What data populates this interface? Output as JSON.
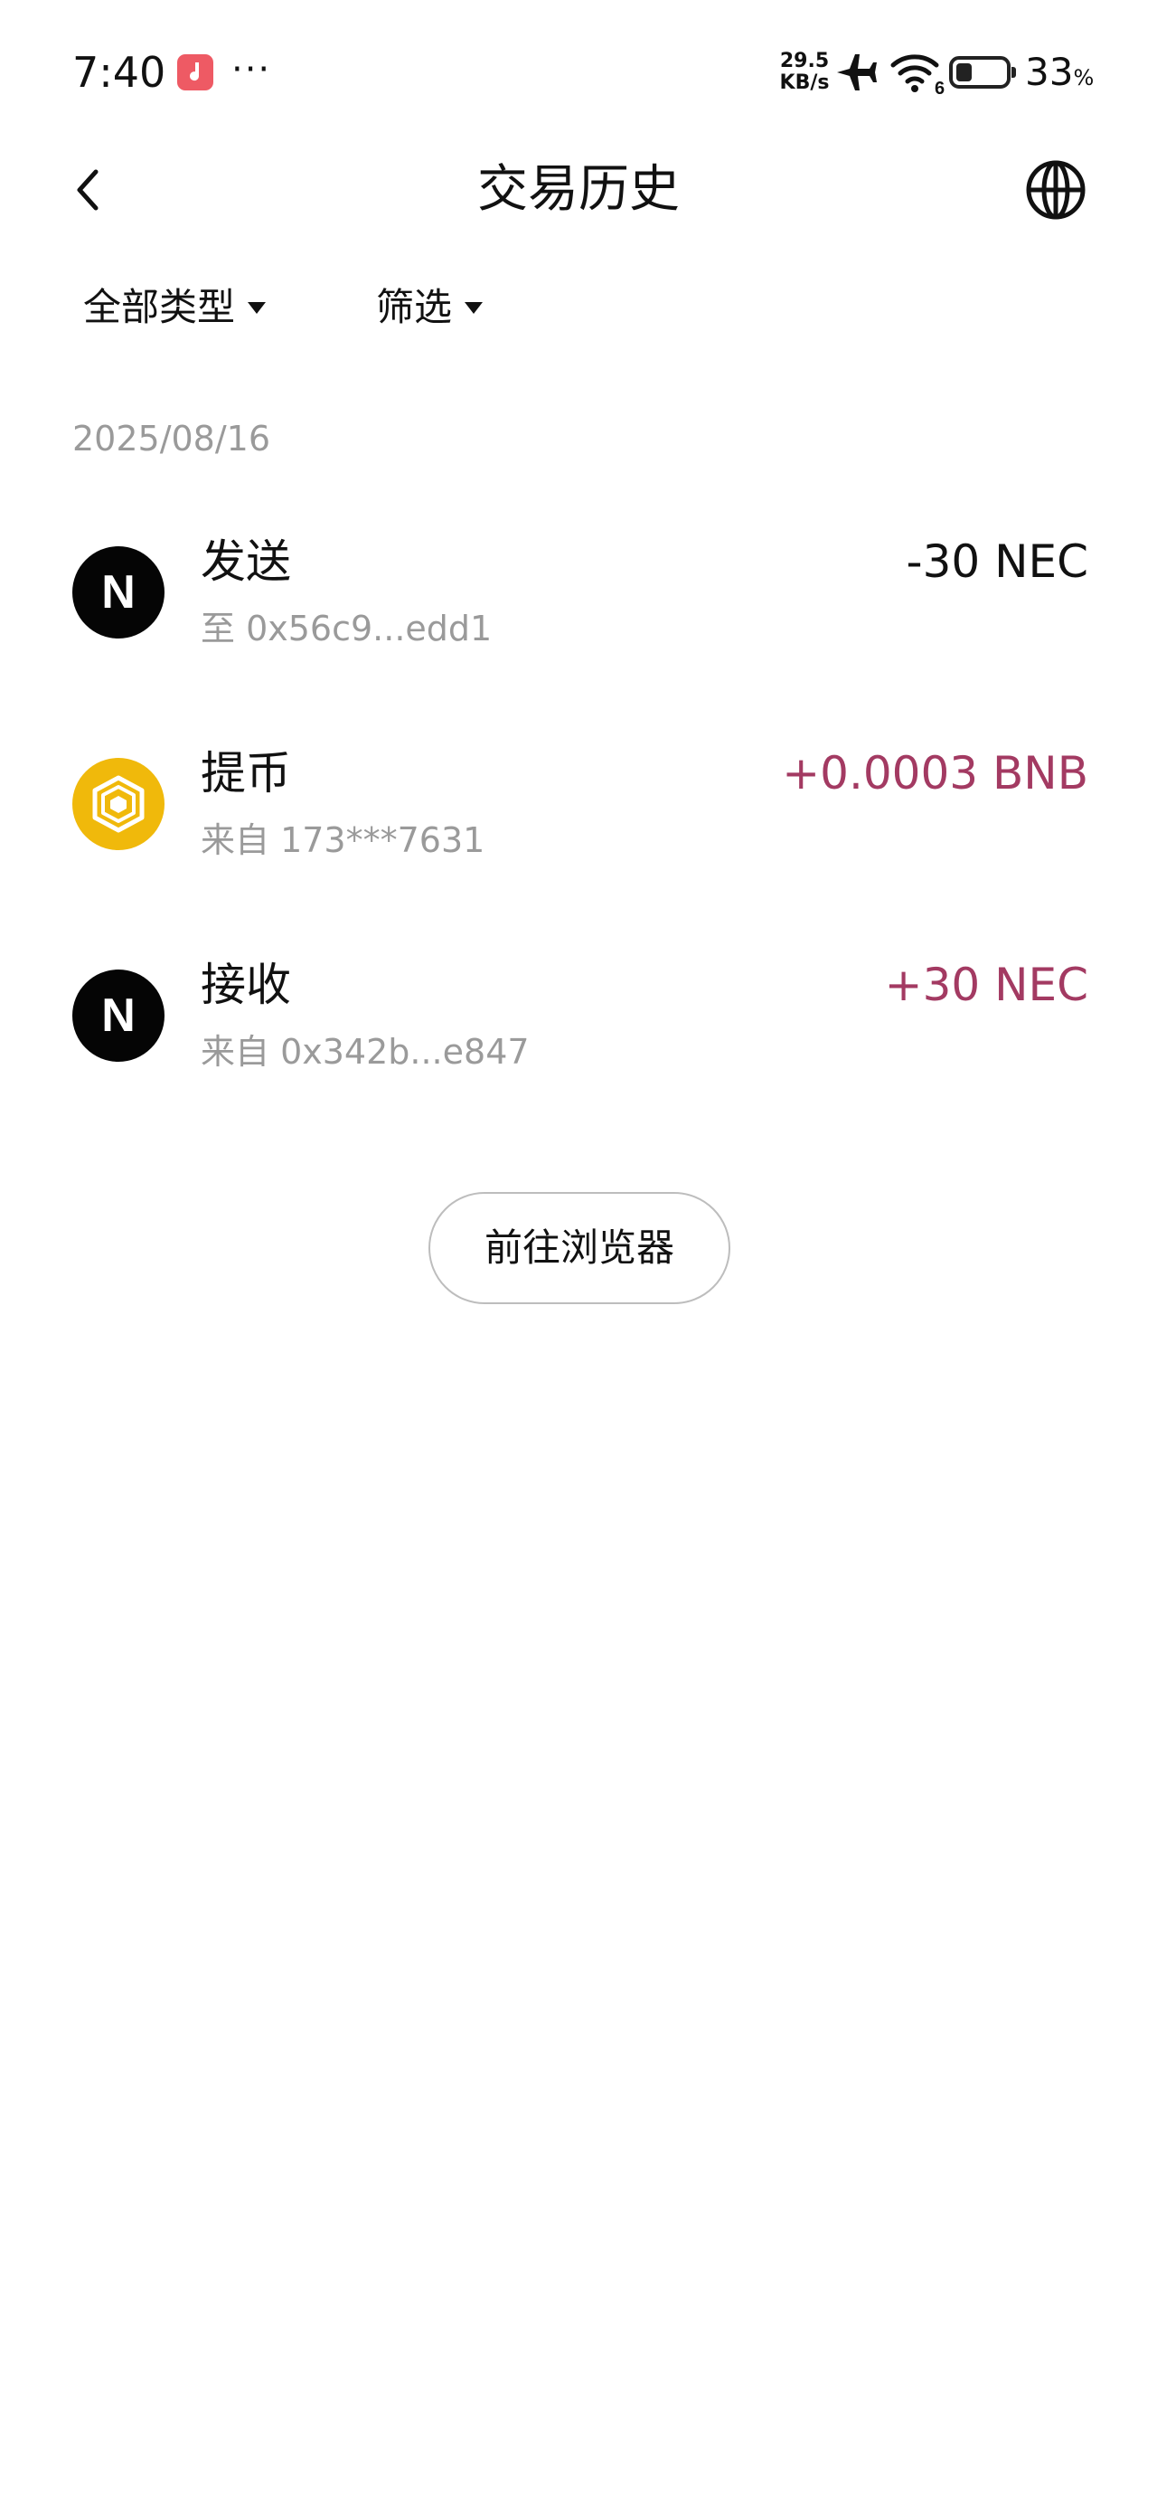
{
  "status_bar": {
    "time": "7:40",
    "more_dots": "···",
    "network_speed_value": "29.5",
    "network_speed_unit": "KB/s",
    "wifi_badge": "6",
    "battery_percent": "33",
    "battery_percent_symbol": "%",
    "battery_level": 0.33,
    "icons": [
      "music-app-icon",
      "airplane-mode-icon",
      "wifi-icon",
      "battery-icon"
    ]
  },
  "header": {
    "title": "交易历史",
    "back_icon": "chevron-left-icon",
    "globe_icon": "globe-icon"
  },
  "filters": {
    "type_label": "全部类型",
    "screen_label": "筛选"
  },
  "date_group": "2025/08/16",
  "transactions": [
    {
      "type": "发送",
      "address": "至 0x56c9...edd1",
      "amount": "-30 NEC",
      "token_letter": "N",
      "direction": "out"
    },
    {
      "type": "提币",
      "address": "来自 173***7631",
      "amount": "+0.0003 BNB",
      "token_icon": "bnb-icon",
      "direction": "in"
    },
    {
      "type": "接收",
      "address": "来自 0x342b...e847",
      "amount": "+30 NEC",
      "token_letter": "N",
      "direction": "in"
    }
  ],
  "explorer_button": "前往浏览器",
  "colors": {
    "positive_amount": "#a33a62",
    "negative_amount": "#111111",
    "bnb_yellow": "#f0b90b",
    "secondary_text": "#9a9a9a"
  }
}
